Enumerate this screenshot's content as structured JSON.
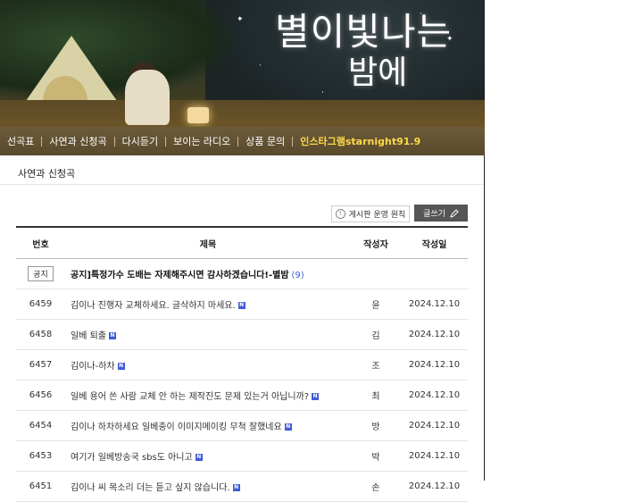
{
  "banner": {
    "logo_line1": "별이빛나는",
    "logo_line2": "밤에"
  },
  "nav": {
    "items": [
      "선곡표",
      "사연과 신청곡",
      "다시듣기",
      "보이는 라디오",
      "상품 문의",
      "인스타그램starnight91.9"
    ]
  },
  "board": {
    "title": "사연과 신청곡",
    "rules_label": "게시판 운영 원칙",
    "write_label": "글쓰기",
    "columns": [
      "번호",
      "제목",
      "작성자",
      "작성일"
    ],
    "notice": {
      "tag": "공지",
      "title": "공지]특정가수 도배는 자제해주시면 감사하겠습니다!-별밤",
      "comments": "(9)"
    },
    "rows": [
      {
        "num": "6459",
        "title": "김이나 진행자 교체하세요. 글삭하지 마세요.",
        "badge": "N",
        "author": "윤",
        "date": "2024.12.10"
      },
      {
        "num": "6458",
        "title": "일베 퇴출",
        "badge": "N",
        "author": "김",
        "date": "2024.12.10"
      },
      {
        "num": "6457",
        "title": "김이나-하차",
        "badge": "N",
        "author": "조",
        "date": "2024.12.10"
      },
      {
        "num": "6456",
        "title": "일베 용어 쓴 사람 교체 안 하는 제작진도 문제 있는거 아닙니까?",
        "badge": "N",
        "author": "최",
        "date": "2024.12.10"
      },
      {
        "num": "6454",
        "title": "김이나 하차하세요 일베충이 이미지메이킹 무척 잘했네요",
        "badge": "N",
        "author": "방",
        "date": "2024.12.10"
      },
      {
        "num": "6453",
        "title": "여기가 일베방송국 sbs도 아니고",
        "badge": "N",
        "author": "박",
        "date": "2024.12.10"
      },
      {
        "num": "6451",
        "title": "김이나 씨 목소리 더는 듣고 싶지 않습니다.",
        "badge": "N",
        "author": "손",
        "date": "2024.12.10"
      }
    ]
  },
  "colors": {
    "nav_bg": "#5a4a2c",
    "nav_highlight": "#ffd84a",
    "new_badge": "#3f5bd6",
    "comment_count": "#3b5fd4",
    "write_button": "#555555"
  }
}
